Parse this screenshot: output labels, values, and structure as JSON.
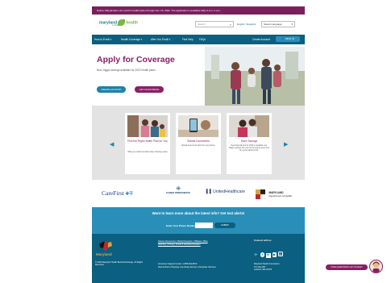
{
  "notice": "Notice: Marylanders can enroll in health plans through Jan. 15, 2022. The application is available daily 3 a.m.-1 a.m.",
  "header": {
    "logo_main": "maryland",
    "logo_word": "health",
    "logo_sub": "connection",
    "search_placeholder": "Search",
    "lang_english": "English",
    "lang_separator": "|",
    "lang_spanish": "Español",
    "select_language": "Select Language"
  },
  "nav": {
    "items": [
      "How to Enroll ▾",
      "Health Coverage ▾",
      "After You Enroll ▾",
      "Find Help",
      "FAQs"
    ],
    "account": "Create Account",
    "signin": "SIGN IN"
  },
  "hero": {
    "title": "Apply for Coverage",
    "subtitle": "New, bigger savings available for 2022 health plans.",
    "create_account": "CREATE ACCOUNT",
    "get_estimate": "GET AN ESTIMATE"
  },
  "carousel": {
    "prev": "◀",
    "next": "▶",
    "cards": [
      {
        "title": "Pick the Right Health Plan for You",
        "desc": "What you should consider when choosing a plan",
        "link": "choosing a plan"
      },
      {
        "title": "Submit Documents",
        "desc": "Upload documents right from your phone.",
        "link": "Learn more"
      },
      {
        "title": "More Savings",
        "desc": "New financial help for 2022 is available now. Bigger savings this year for all income levels and for young adults 18-34.",
        "link": "New financial help"
      }
    ]
  },
  "partners": {
    "carefirst": "CareFirst",
    "kaiser": "KAISER PERMANENTE.",
    "united": "UnitedHealthcare",
    "md_line1": "MARYLAND",
    "md_line2": "Department of Health"
  },
  "alert": {
    "heading": "Want to learn more about the latest info? Get text alerts!",
    "phone_label": "Enter Your Phone Number",
    "submit": "SUBMIT"
  },
  "footer": {
    "logo_text": "Maryland",
    "copyright": "© 2022 Maryland Health Benefit Exchange. All Rights Reserved.",
    "links_line1": "Partner Resources | Media Requests | Affiliates | Blog",
    "links_line2": "Glossary | Privacy, Fraud & Nondiscrimination",
    "support_line1": "Consumer Support Center: 1-855-642-8572",
    "support_line2": "Deaf & Hard of Hearing: Use Relay Service | Interpreter Services",
    "connect": "Connect with us",
    "addr_line1": "Maryland Health Connection",
    "addr_line2": "P.O. Box 857",
    "addr_line3": "Lanham, MD 20703"
  },
  "chat": {
    "label": "HAVE QUESTIONS? LET US HELP!"
  },
  "colors": {
    "brand_purple": "#8a1f64",
    "brand_teal": "#0b5f80",
    "brand_blue": "#2a8fb8",
    "brand_green": "#7ab648"
  }
}
